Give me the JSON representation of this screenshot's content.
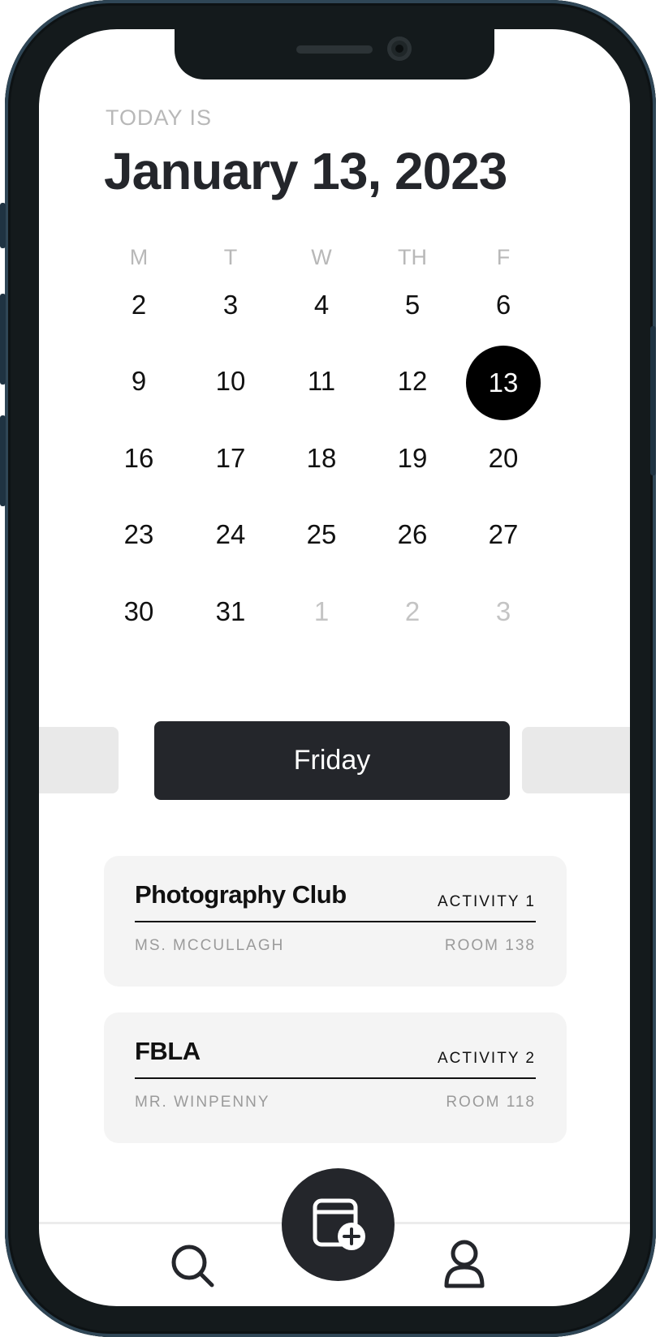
{
  "header": {
    "today_label": "TODAY IS",
    "date": "January 13, 2023"
  },
  "calendar": {
    "weekdays": [
      "M",
      "T",
      "W",
      "TH",
      "F"
    ],
    "weeks": [
      [
        "2",
        "3",
        "4",
        "5",
        "6"
      ],
      [
        "9",
        "10",
        "11",
        "12",
        "13"
      ],
      [
        "16",
        "17",
        "18",
        "19",
        "20"
      ],
      [
        "23",
        "24",
        "25",
        "26",
        "27"
      ],
      [
        "30",
        "31",
        "1",
        "2",
        "3"
      ]
    ],
    "selected_day": "13"
  },
  "day_selector": {
    "current": "Friday"
  },
  "activities": [
    {
      "title": "Photography Club",
      "tag": "ACTIVITY 1",
      "teacher": "MS. MCCULLAGH",
      "room": "ROOM 138"
    },
    {
      "title": "FBLA",
      "tag": "ACTIVITY 2",
      "teacher": "MR. WINPENNY",
      "room": "ROOM 118"
    }
  ],
  "tabbar": {
    "icons": [
      "search-icon",
      "add-calendar-icon",
      "profile-icon"
    ]
  },
  "colors": {
    "primary_dark": "#24262b",
    "muted_text": "#b8b8b8",
    "card_bg": "#f4f4f4"
  }
}
